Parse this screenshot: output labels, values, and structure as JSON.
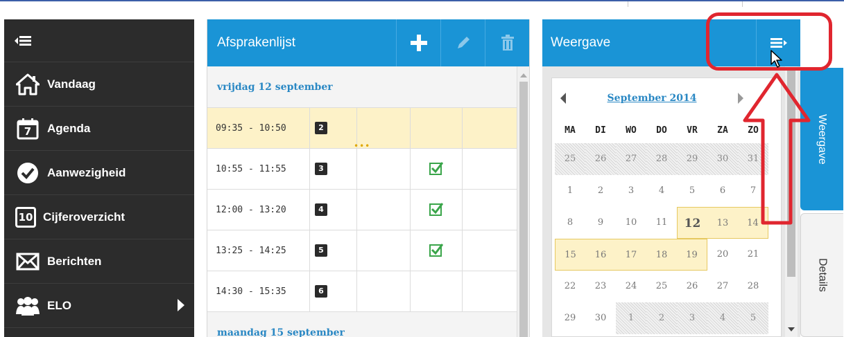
{
  "colors": {
    "accent": "#1a94d6",
    "sidebar_bg": "#2c2c2c",
    "highlight": "#fdf2c8",
    "annotation": "#e0262f"
  },
  "sidebar": {
    "toggle_icon": "collapse-menu-icon",
    "items": [
      {
        "label": "Vandaag",
        "icon": "home-icon"
      },
      {
        "label": "Agenda",
        "icon": "calendar-icon",
        "icon_text": "7"
      },
      {
        "label": "Aanwezigheid",
        "icon": "check-circle-icon"
      },
      {
        "label": "Cijferoverzicht",
        "icon": "grade-icon",
        "icon_text": "10"
      },
      {
        "label": "Berichten",
        "icon": "envelope-icon"
      },
      {
        "label": "ELO",
        "icon": "users-icon"
      }
    ]
  },
  "appointments": {
    "title": "Afsprakenlijst",
    "buttons": [
      "plus-icon",
      "pencil-icon",
      "trash-icon"
    ],
    "day1": "vrijdag 12 september",
    "rows": [
      {
        "time": "09:35 - 10:50",
        "hour": "2",
        "checked": false,
        "highlighted": true
      },
      {
        "time": "10:55 - 11:55",
        "hour": "3",
        "checked": true
      },
      {
        "time": "12:00 - 13:20",
        "hour": "4",
        "checked": true
      },
      {
        "time": "13:25 - 14:25",
        "hour": "5",
        "checked": true
      },
      {
        "time": "14:30 - 15:35",
        "hour": "6",
        "checked": false
      }
    ],
    "day2": "maandag 15 september"
  },
  "view": {
    "title": "Weergave",
    "menu_icon": "menu-expand-icon",
    "calendar": {
      "month": "September 2014",
      "dow": [
        "MA",
        "DI",
        "WO",
        "DO",
        "VR",
        "ZA",
        "ZO"
      ],
      "weeks": [
        [
          "25",
          "26",
          "27",
          "28",
          "29",
          "30",
          "31"
        ],
        [
          "1",
          "2",
          "3",
          "4",
          "5",
          "6",
          "7"
        ],
        [
          "8",
          "9",
          "10",
          "11",
          "12",
          "13",
          "14"
        ],
        [
          "15",
          "16",
          "17",
          "18",
          "19",
          "20",
          "21"
        ],
        [
          "22",
          "23",
          "24",
          "25",
          "26",
          "27",
          "28"
        ],
        [
          "29",
          "30",
          "1",
          "2",
          "3",
          "4",
          "5"
        ]
      ],
      "today": "12"
    }
  },
  "tabs": {
    "weergave": "Weergave",
    "details": "Details"
  }
}
